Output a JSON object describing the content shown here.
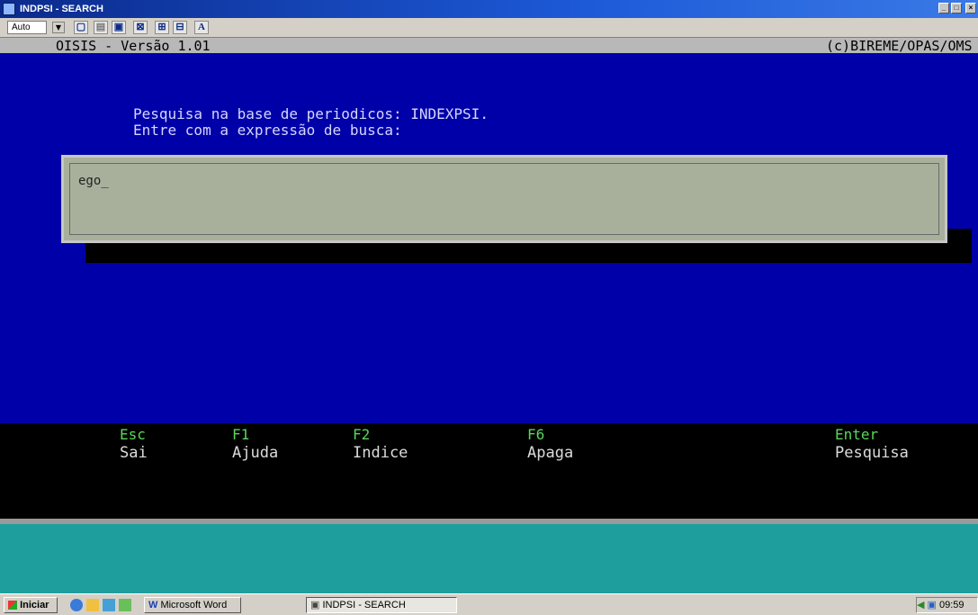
{
  "window": {
    "title": "INDPSI - SEARCH"
  },
  "toolbar": {
    "font_size": "Auto"
  },
  "console": {
    "program": "OISIS - Versão 1.01",
    "copyright": "(c)BIREME/OPAS/OMS",
    "prompt_line1": "Pesquisa na base de periodicos: INDEXPSI.",
    "prompt_line2": "Entre com a expressão de busca:",
    "search_value": "ego_"
  },
  "function_keys": [
    {
      "key": "Esc",
      "label": "Sai"
    },
    {
      "key": "F1",
      "label": "Ajuda"
    },
    {
      "key": "F2",
      "label": "Indice"
    },
    {
      "key": "F6",
      "label": "Apaga"
    },
    {
      "key": "Enter",
      "label": "Pesquisa"
    }
  ],
  "taskbar": {
    "start": "Iniciar",
    "word_task": "Microsoft Word",
    "search_task": "INDPSI - SEARCH",
    "clock": "09:59"
  },
  "colors": {
    "console_bg": "#0000a8",
    "fkey": "#59d65a",
    "teal": "#1f9e9e"
  }
}
